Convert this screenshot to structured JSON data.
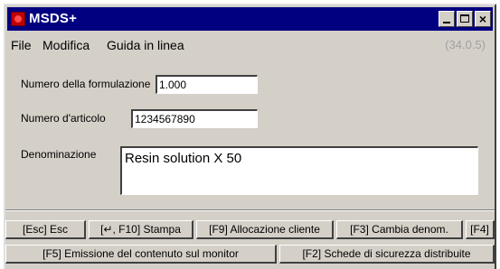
{
  "window": {
    "title": "MSDS+",
    "icon": "msds-app-icon",
    "controls": {
      "minimize": "minimize-icon",
      "maximize": "maximize-icon",
      "close": "×"
    }
  },
  "menu": {
    "items": [
      "File",
      "Modifica",
      "Guida in linea"
    ],
    "code": "(34.0.5)"
  },
  "form": {
    "formulation_label": "Numero della formulazione",
    "formulation_value": "1.000",
    "article_label": "Numero d'articolo",
    "article_value": "1234567890",
    "denomination_label": "Denominazione",
    "denomination_value": "Resin solution X 50"
  },
  "buttons_row1": [
    "[Esc] Esc",
    "[↵, F10] Stampa",
    "[F9] Allocazione cliente",
    "[F3] Cambia denom.",
    "[F4]"
  ],
  "buttons_row2": [
    "[F5] Emissione del contenuto sul monitor",
    "[F2] Schede di sicurezza distribuite"
  ],
  "colors": {
    "titlebar": "#000080",
    "face": "#d4d0c8",
    "code_text": "#a0a0a0"
  }
}
